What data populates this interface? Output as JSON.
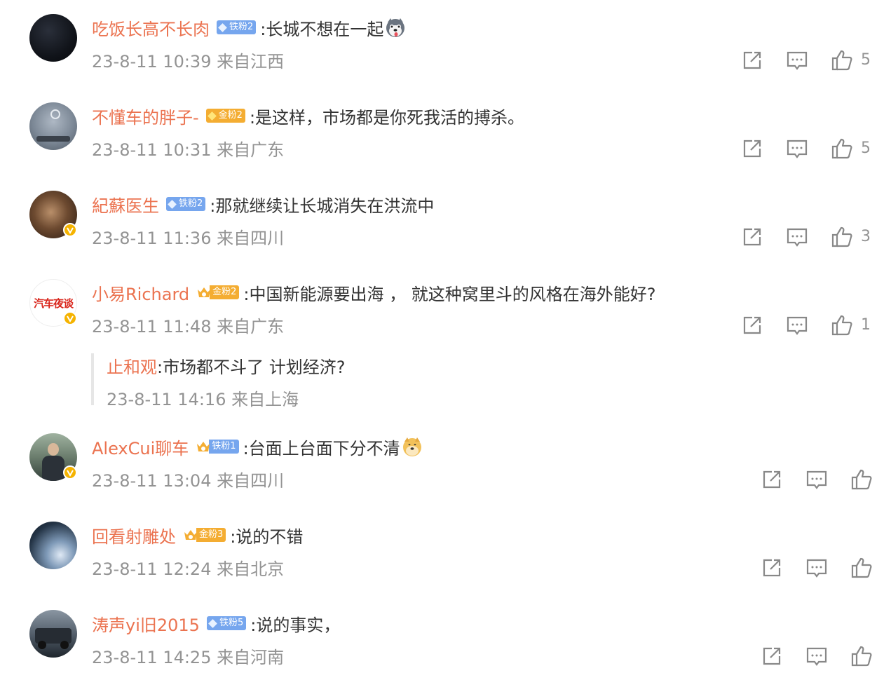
{
  "comments": [
    {
      "username": "吃饭长高不长肉",
      "badge": "铁粉2",
      "badge_type": "iron",
      "crown": false,
      "text": ":长城不想在一起",
      "emoji": "husky-emoji",
      "time": "23-8-11 10:39 来自江西",
      "likes": "5",
      "verified": false,
      "avatar": "dark-avatar"
    },
    {
      "username": "不懂车的胖子-",
      "badge": "金粉2",
      "badge_type": "gold",
      "crown": false,
      "text": ":是这样，市场都是你死我活的搏杀。",
      "emoji": "",
      "time": "23-8-11 10:31 来自广东",
      "likes": "5",
      "verified": false,
      "avatar": "car-dashboard-avatar"
    },
    {
      "username": "紀蘇医生",
      "badge": "铁粉2",
      "badge_type": "iron",
      "crown": false,
      "text": ":那就继续让长城消失在洪流中",
      "emoji": "",
      "time": "23-8-11 11:36 来自四川",
      "likes": "3",
      "verified": true,
      "avatar": "portrait-avatar"
    },
    {
      "username": "小易Richard",
      "badge": "金粉2",
      "badge_type": "gold",
      "crown": true,
      "text": ":中国新能源要出海 ， 就这种窝里斗的风格在海外能好?",
      "emoji": "",
      "time": "23-8-11 11:48 来自广东",
      "likes": "1",
      "verified": true,
      "avatar": "汽车夜谈"
    },
    {
      "username": "AlexCui聊车",
      "badge": "铁粉1",
      "badge_type": "iron",
      "crown": true,
      "text": ":台面上台面下分不清",
      "emoji": "doge-emoji",
      "time": "23-8-11 13:04 来自四川",
      "likes": "",
      "verified": true,
      "avatar": "person-avatar"
    },
    {
      "username": "回看射雕处",
      "badge": "金粉3",
      "badge_type": "gold",
      "crown": true,
      "text": ":说的不错",
      "emoji": "",
      "time": "23-8-11 12:24 来自北京",
      "likes": "",
      "verified": false,
      "avatar": "planet-avatar"
    },
    {
      "username": "涛声yi旧2015",
      "badge": "铁粉5",
      "badge_type": "iron",
      "crown": false,
      "text": ":说的事实，",
      "emoji": "",
      "time": "23-8-11 14:25 来自河南",
      "likes": "",
      "verified": false,
      "avatar": "suv-avatar"
    }
  ],
  "reply": {
    "username": "止和观",
    "text": ":市场都不斗了 计划经济?",
    "time": "23-8-11 14:16 来自上海"
  },
  "colors": {
    "username": "#eb7350",
    "meta": "#939393",
    "iron_badge": "#76a6ee",
    "gold_badge": "#f4ad32",
    "verified": "#f5b300"
  }
}
